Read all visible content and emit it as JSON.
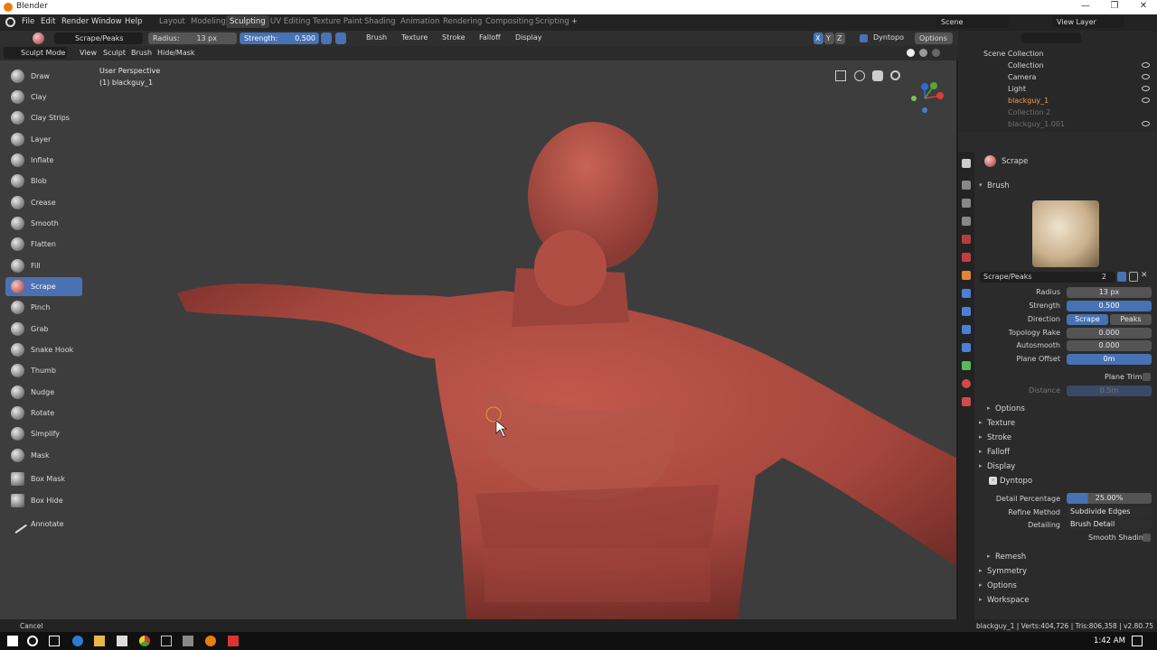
{
  "titlebar": {
    "title": "Blender",
    "minimize": "—",
    "maximize": "❐",
    "close": "✕"
  },
  "menu": [
    "File",
    "Edit",
    "Render",
    "Window",
    "Help"
  ],
  "workspace_tabs": [
    "Layout",
    "Modeling",
    "Sculpting",
    "UV Editing",
    "Texture Paint",
    "Shading",
    "Animation",
    "Rendering",
    "Compositing",
    "Scripting"
  ],
  "active_tab": "Sculpting",
  "add_tab": "+",
  "scene": "Scene",
  "view_layer": "View Layer",
  "tool_header": {
    "brush_name": "Scrape/Peaks",
    "radius_label": "Radius:",
    "radius_value": "13 px",
    "strength_label": "Strength:",
    "strength_value": "0.500",
    "menus": [
      "Brush",
      "Texture",
      "Stroke",
      "Falloff",
      "Display"
    ],
    "axes": [
      "X",
      "Y",
      "Z"
    ],
    "dyntopo": "Dyntopo",
    "options": "Options"
  },
  "mode_header": {
    "mode": "Sculpt Mode",
    "menus": [
      "View",
      "Sculpt",
      "Brush",
      "Hide/Mask"
    ]
  },
  "viewport": {
    "perspective": "User Perspective",
    "object": "(1) blackguy_1"
  },
  "tools": [
    "Draw",
    "Clay",
    "Clay Strips",
    "Layer",
    "Inflate",
    "Blob",
    "Crease",
    "Smooth",
    "Flatten",
    "Fill",
    "Scrape",
    "Pinch",
    "Grab",
    "Snake Hook",
    "Thumb",
    "Nudge",
    "Rotate",
    "Simplify",
    "Mask"
  ],
  "active_tool": "Scrape",
  "tools2": [
    "Box Mask",
    "Box Hide"
  ],
  "tools3": [
    "Annotate"
  ],
  "outliner": {
    "root": "Scene Collection",
    "rows": [
      {
        "name": "Collection",
        "indent": 1
      },
      {
        "name": "Camera",
        "indent": 2
      },
      {
        "name": "Light",
        "indent": 2
      },
      {
        "name": "blackguy_1",
        "indent": 2
      },
      {
        "name": "Collection 2",
        "indent": 1
      },
      {
        "name": "blackguy_1.001",
        "indent": 2
      }
    ]
  },
  "properties": {
    "tool_name": "Scrape",
    "brush_section": "Brush",
    "brush_name": "Scrape/Peaks",
    "brush_users": "2",
    "radius_label": "Radius",
    "radius": "13 px",
    "strength_label": "Strength",
    "strength": "0.500",
    "direction_label": "Direction",
    "direction_a": "Scrape",
    "direction_b": "Peaks",
    "topology_label": "Topology Rake",
    "topology": "0.000",
    "autosmooth_label": "Autosmooth",
    "autosmooth": "0.000",
    "plane_offset_label": "Plane Offset",
    "plane_offset": "0m",
    "plane_trim": "Plane Trim",
    "distance_label": "Distance",
    "distance": "0.5m",
    "options_sub": "Options",
    "sections": [
      "Texture",
      "Stroke",
      "Falloff",
      "Display"
    ],
    "dyntopo": "Dyntopo",
    "detail_label": "Detail Percentage",
    "detail": "25.00%",
    "refine_label": "Refine Method",
    "refine": "Subdivide Edges",
    "detailing_label": "Detailing",
    "detailing": "Brush Detail",
    "smooth_shading": "Smooth Shading",
    "remesh": "Remesh",
    "sections2": [
      "Symmetry",
      "Options",
      "Workspace"
    ]
  },
  "status": {
    "left": "Cancel",
    "right": "blackguy_1 | Verts:404,726 | Tris:806,358 | v2.80.75"
  },
  "taskbar": {
    "time": "1:42 AM"
  },
  "colors": {
    "accent": "#4772b3",
    "skin": "#a9483f",
    "bg": "#3d3d3d"
  }
}
